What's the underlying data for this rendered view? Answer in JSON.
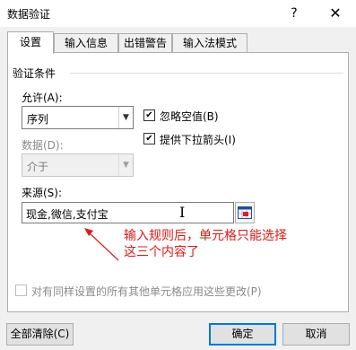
{
  "window": {
    "title": "数据验证",
    "help_label": "?",
    "close_label": "✕"
  },
  "tabs": [
    {
      "label": "设置",
      "active": true
    },
    {
      "label": "输入信息",
      "active": false
    },
    {
      "label": "出错警告",
      "active": false
    },
    {
      "label": "输入法模式",
      "active": false
    }
  ],
  "validation": {
    "group_label": "验证条件",
    "allow_label": "允许(A):",
    "allow_value": "序列",
    "data_label": "数据(D):",
    "data_value": "介于",
    "ignore_blank_label": "忽略空值(B)",
    "ignore_blank_checked": true,
    "dropdown_label": "提供下拉箭头(I)",
    "dropdown_checked": true,
    "source_label": "来源(S):",
    "source_value": "现金,微信,支付宝"
  },
  "annotation": {
    "line1": "输入规则后，单元格只能选择",
    "line2": "这三个内容了",
    "color": "#e01818"
  },
  "footer": {
    "apply_all_label": "对有同样设置的所有其他单元格应用这些更改(P)",
    "apply_all_checked": false,
    "clear_all_label": "全部清除(C)",
    "ok_label": "确定",
    "cancel_label": "取消"
  },
  "icons": {
    "dropdown": "chevron-down-icon",
    "check": "check-icon",
    "collapse": "range-select-icon",
    "cursor": "ibeam-cursor-icon"
  },
  "colors": {
    "focus_border": "#0078d7",
    "annotation_red": "#e01818"
  }
}
